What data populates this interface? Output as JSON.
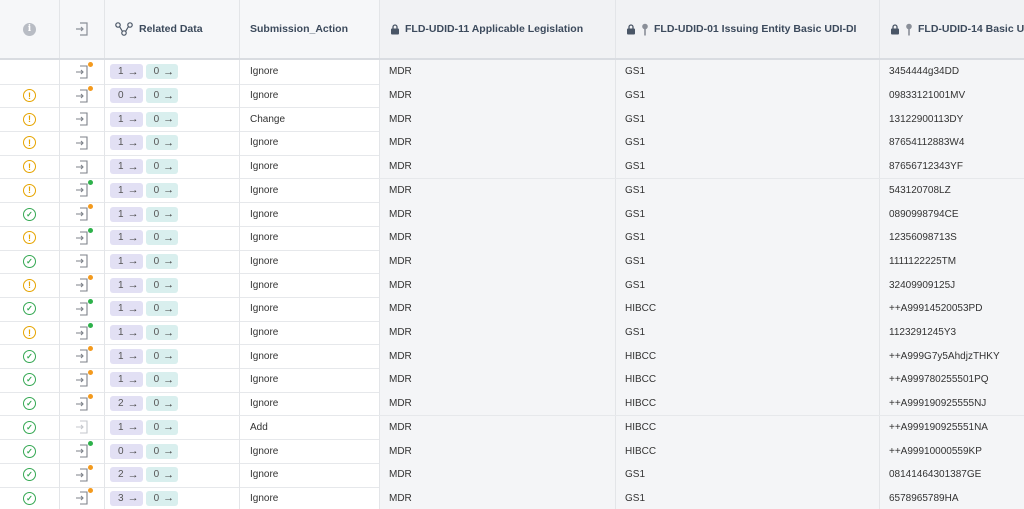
{
  "header": {
    "related_label": "Related Data",
    "submission_label": "Submission_Action",
    "col_legislation": "FLD-UDID-11 Applicable Legislation",
    "col_issuing": "FLD-UDID-01 Issuing Entity Basic UDI-DI",
    "col_basic": "FLD-UDID-14 Basic U"
  },
  "arrow_glyph": "→",
  "rows": [
    {
      "status": "none",
      "dot": "orange",
      "out": "1",
      "in": "0",
      "action": "Ignore",
      "legislation": "MDR",
      "issuer": "GS1",
      "udi": "3454444g34DD"
    },
    {
      "status": "warn",
      "dot": "orange",
      "out": "0",
      "in": "0",
      "action": "Ignore",
      "legislation": "MDR",
      "issuer": "GS1",
      "udi": "09833121001MV"
    },
    {
      "status": "warn",
      "dot": "none",
      "out": "1",
      "in": "0",
      "action": "Change",
      "legislation": "MDR",
      "issuer": "GS1",
      "udi": "13122900113DY"
    },
    {
      "status": "warn",
      "dot": "none",
      "out": "1",
      "in": "0",
      "action": "Ignore",
      "legislation": "MDR",
      "issuer": "GS1",
      "udi": "87654112883W4"
    },
    {
      "status": "warn",
      "dot": "none",
      "out": "1",
      "in": "0",
      "action": "Ignore",
      "legislation": "MDR",
      "issuer": "GS1",
      "udi": "87656712343YF"
    },
    {
      "status": "warn",
      "dot": "green",
      "out": "1",
      "in": "0",
      "action": "Ignore",
      "legislation": "MDR",
      "issuer": "GS1",
      "udi": "543120708LZ"
    },
    {
      "status": "ok",
      "dot": "orange",
      "out": "1",
      "in": "0",
      "action": "Ignore",
      "legislation": "MDR",
      "issuer": "GS1",
      "udi": "0890998794CE"
    },
    {
      "status": "warn",
      "dot": "green",
      "out": "1",
      "in": "0",
      "action": "Ignore",
      "legislation": "MDR",
      "issuer": "GS1",
      "udi": "12356098713S"
    },
    {
      "status": "ok",
      "dot": "none",
      "out": "1",
      "in": "0",
      "action": "Ignore",
      "legislation": "MDR",
      "issuer": "GS1",
      "udi": "1111122225TM"
    },
    {
      "status": "warn",
      "dot": "orange",
      "out": "1",
      "in": "0",
      "action": "Ignore",
      "legislation": "MDR",
      "issuer": "GS1",
      "udi": "32409909125J"
    },
    {
      "status": "ok",
      "dot": "green",
      "out": "1",
      "in": "0",
      "action": "Ignore",
      "legislation": "MDR",
      "issuer": "HIBCC",
      "udi": "++A99914520053PD"
    },
    {
      "status": "warn",
      "dot": "green",
      "out": "1",
      "in": "0",
      "action": "Ignore",
      "legislation": "MDR",
      "issuer": "GS1",
      "udi": "1123291245Y3"
    },
    {
      "status": "ok",
      "dot": "orange",
      "out": "1",
      "in": "0",
      "action": "Ignore",
      "legislation": "MDR",
      "issuer": "HIBCC",
      "udi": "++A999G7y5AhdjzTHKY"
    },
    {
      "status": "ok",
      "dot": "orange",
      "out": "1",
      "in": "0",
      "action": "Ignore",
      "legislation": "MDR",
      "issuer": "HIBCC",
      "udi": "++A999780255501PQ"
    },
    {
      "status": "ok",
      "dot": "orange",
      "out": "2",
      "in": "0",
      "action": "Ignore",
      "legislation": "MDR",
      "issuer": "HIBCC",
      "udi": "++A999190925555NJ"
    },
    {
      "status": "ok",
      "dot": "none",
      "faded": true,
      "out": "1",
      "in": "0",
      "action": "Add",
      "legislation": "MDR",
      "issuer": "HIBCC",
      "udi": "++A999190925551NA"
    },
    {
      "status": "ok",
      "dot": "green",
      "out": "0",
      "in": "0",
      "action": "Ignore",
      "legislation": "MDR",
      "issuer": "HIBCC",
      "udi": "++A99910000559KP"
    },
    {
      "status": "ok",
      "dot": "orange",
      "out": "2",
      "in": "0",
      "action": "Ignore",
      "legislation": "MDR",
      "issuer": "GS1",
      "udi": "08141464301387GE"
    },
    {
      "status": "ok",
      "dot": "orange",
      "out": "3",
      "in": "0",
      "action": "Ignore",
      "legislation": "MDR",
      "issuer": "GS1",
      "udi": "6578965789HA"
    }
  ]
}
